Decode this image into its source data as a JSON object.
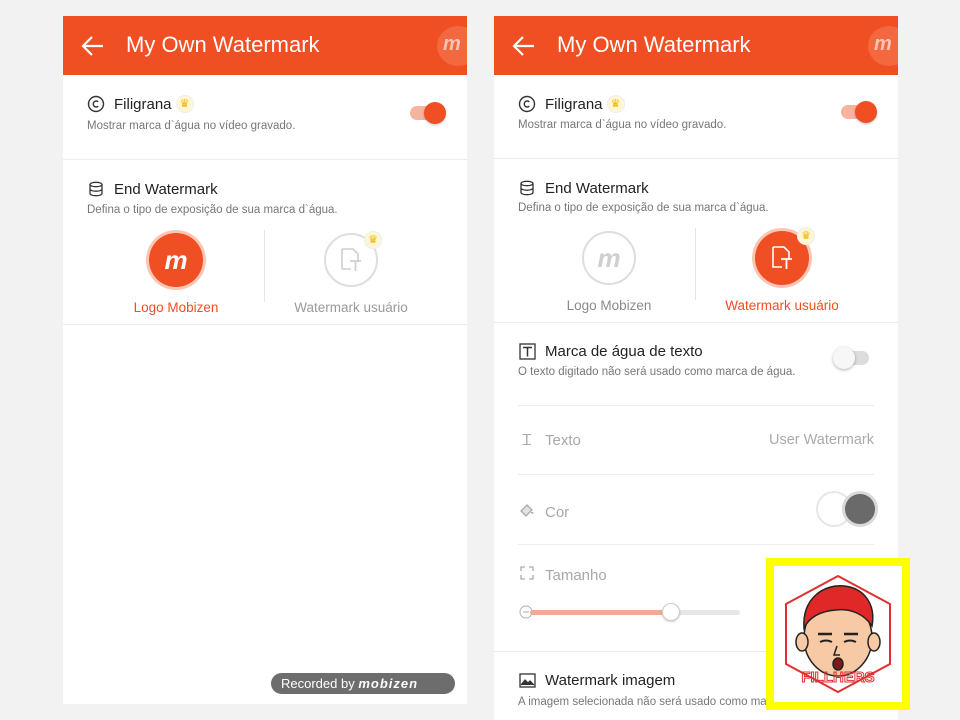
{
  "left": {
    "appbar": {
      "title": "My Own Watermark",
      "logo_letter": "m"
    },
    "watermark_row": {
      "title": "Filigrana",
      "subtitle": "Mostrar marca d`água no vídeo gravado.",
      "toggle_on": true
    },
    "end_watermark": {
      "title": "End Watermark",
      "subtitle": "Defina o tipo de exposição de sua marca d`água.",
      "options": [
        {
          "label": "Logo Mobizen",
          "selected": true
        },
        {
          "label": "Watermark usuário",
          "selected": false
        }
      ]
    },
    "recorded_badge": {
      "prefix": "Recorded by",
      "brand": "mobizen"
    }
  },
  "right": {
    "appbar": {
      "title": "My Own Watermark",
      "logo_letter": "m"
    },
    "watermark_row": {
      "title": "Filigrana",
      "subtitle": "Mostrar marca d`água no vídeo gravado.",
      "toggle_on": true
    },
    "end_watermark": {
      "title": "End Watermark",
      "subtitle": "Defina o tipo de exposição de sua marca d`água.",
      "options": [
        {
          "label": "Logo Mobizen",
          "selected": false
        },
        {
          "label": "Watermark usuário",
          "selected": true
        }
      ]
    },
    "text_watermark": {
      "title": "Marca de água de texto",
      "subtitle": "O texto digitado não será usado como marca de água.",
      "toggle_on": false,
      "texto_label": "Texto",
      "texto_value": "User Watermark",
      "cor_label": "Cor",
      "tamanho_label": "Tamanho",
      "size_fraction": 0.67
    },
    "image_watermark": {
      "title": "Watermark imagem",
      "subtitle": "A imagem selecionada não será usado como marca de água."
    }
  },
  "overlay": {
    "caption": "FILLHERS"
  },
  "colors": {
    "accent": "#f04e23",
    "highlight": "#ffff00"
  }
}
